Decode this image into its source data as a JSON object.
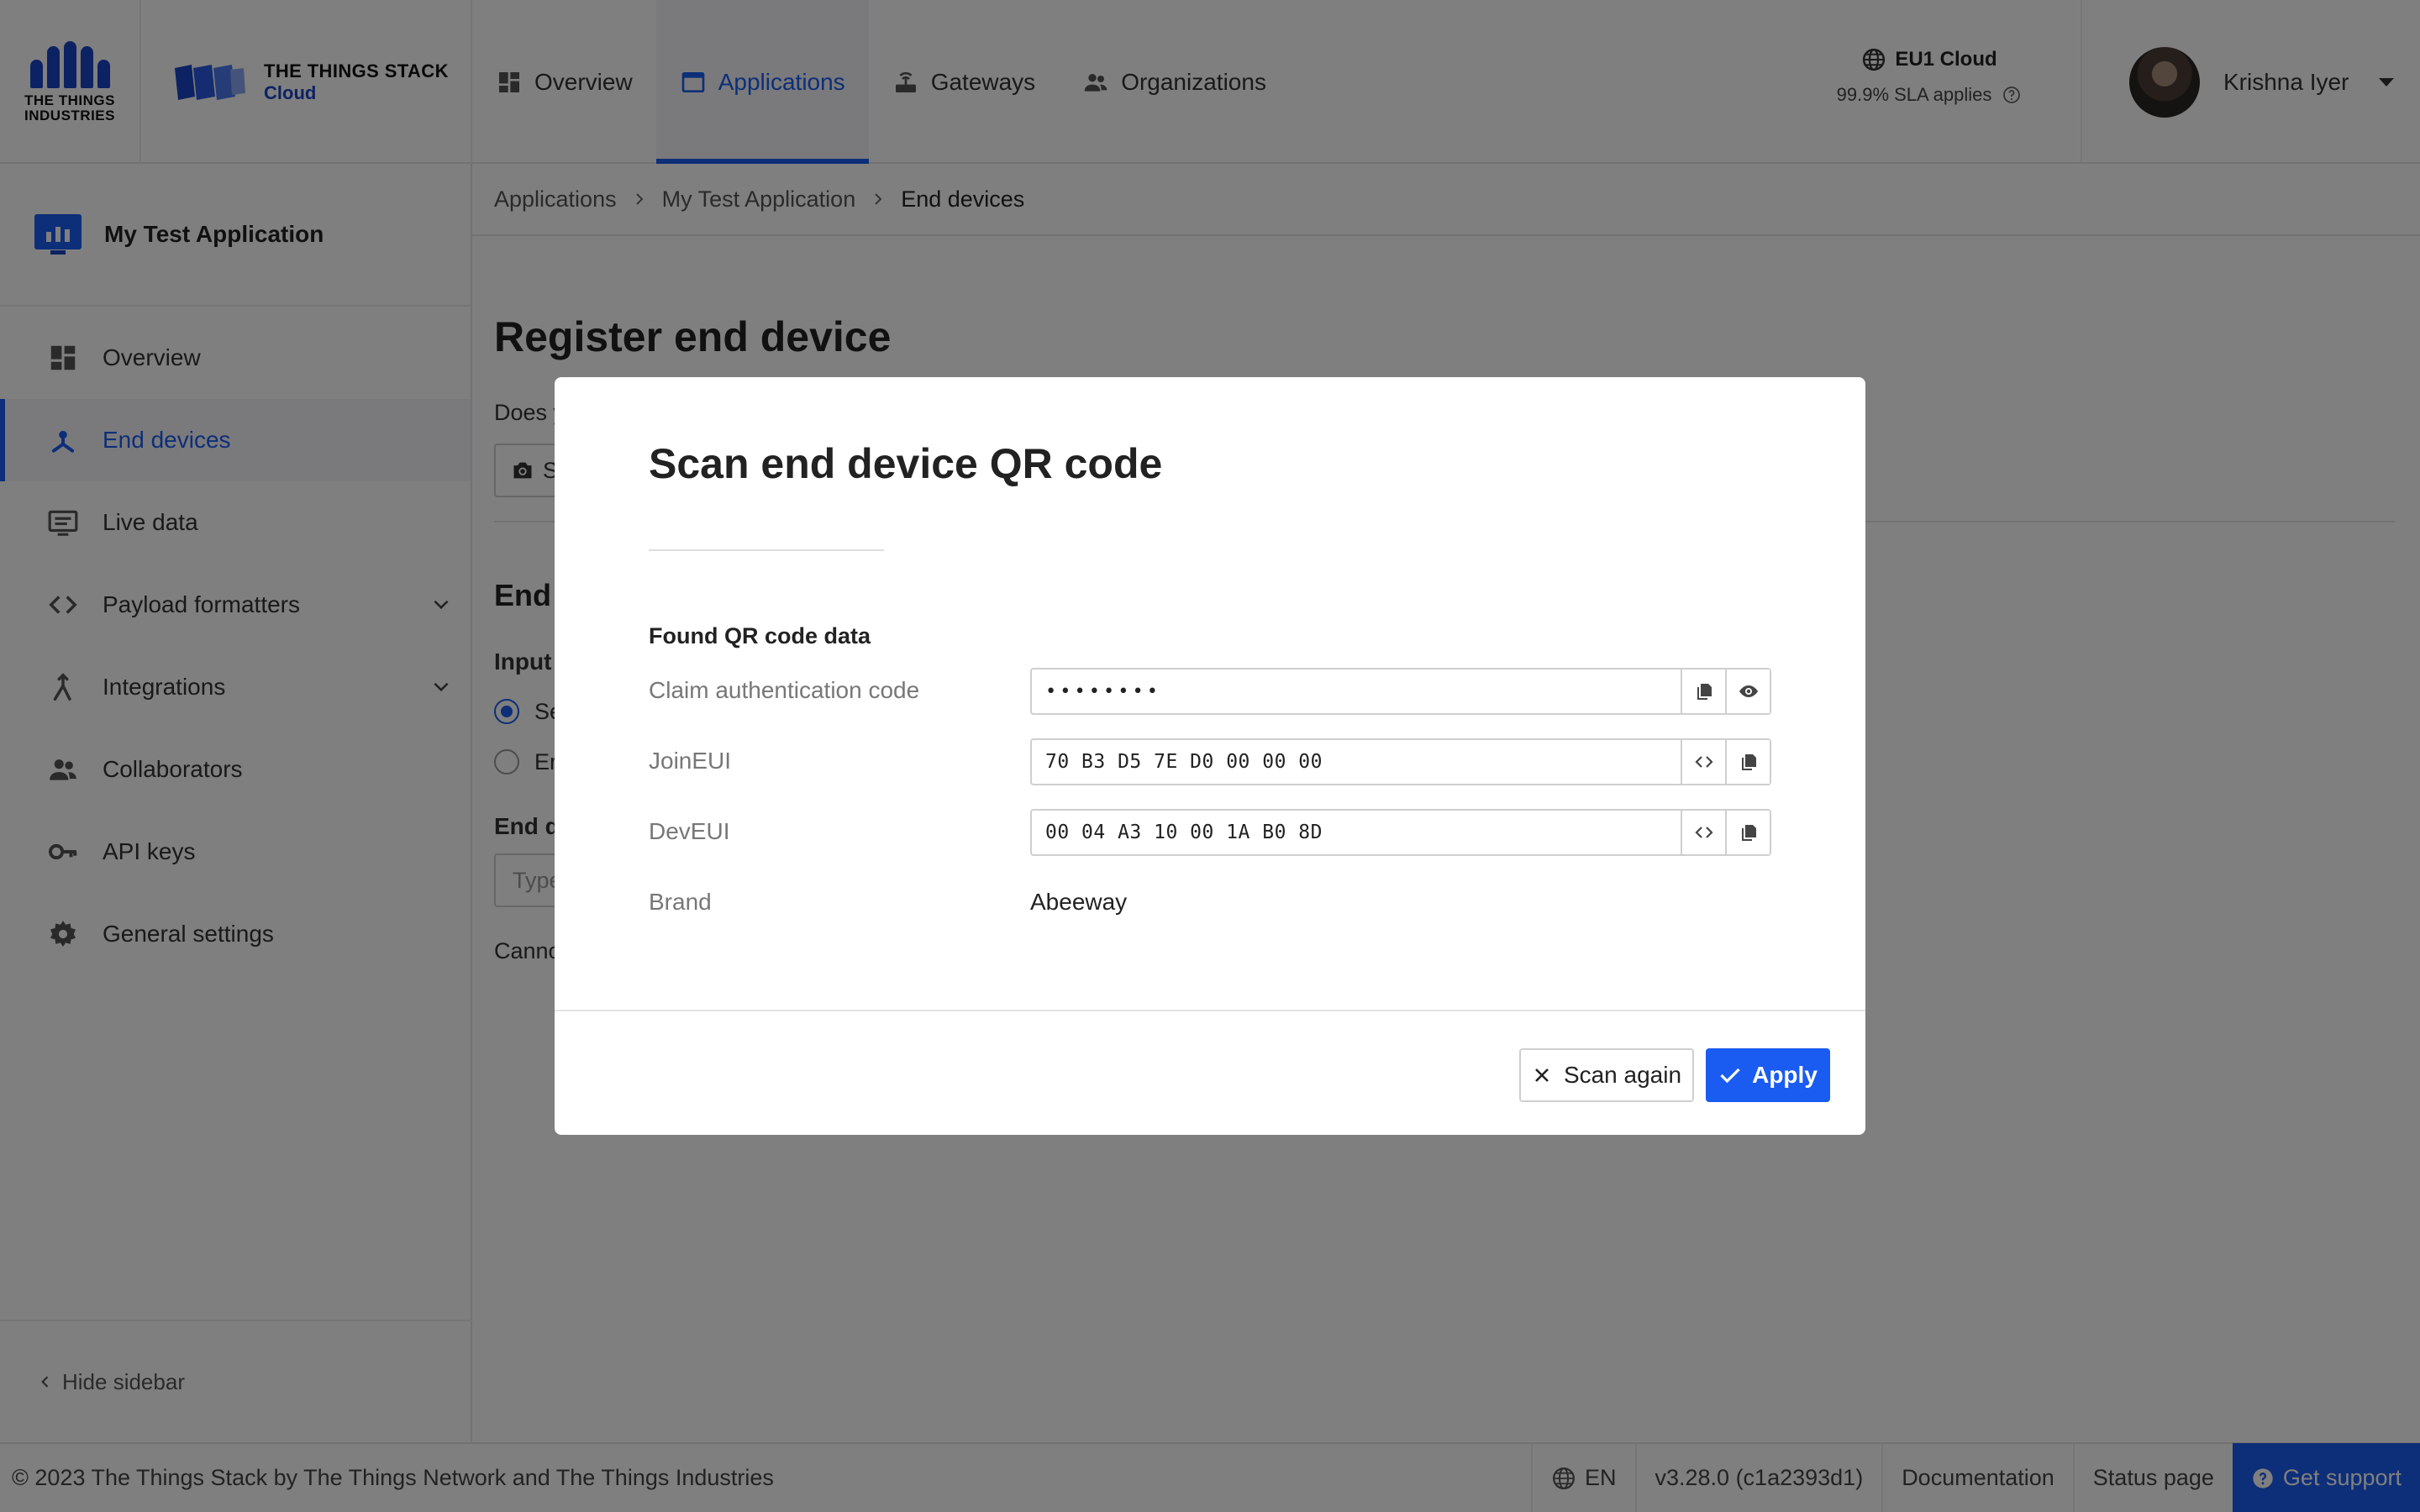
{
  "header": {
    "tti_logo_text": "THE THINGS INDUSTRIES",
    "tts_line1": "THE THINGS STACK",
    "tts_line2": "Cloud",
    "nav": [
      {
        "label": "Overview",
        "icon": "dashboard-icon"
      },
      {
        "label": "Applications",
        "icon": "application-icon",
        "active": true
      },
      {
        "label": "Gateways",
        "icon": "gateway-icon"
      },
      {
        "label": "Organizations",
        "icon": "organizations-icon"
      }
    ],
    "cluster": {
      "name": "EU1 Cloud",
      "sla": "99.9% SLA applies"
    },
    "user": {
      "name": "Krishna Iyer"
    }
  },
  "sidebar": {
    "app_title": "My Test Application",
    "items": [
      {
        "label": "Overview",
        "icon": "dashboard-icon"
      },
      {
        "label": "End devices",
        "icon": "devices-icon",
        "active": true
      },
      {
        "label": "Live data",
        "icon": "live-data-icon"
      },
      {
        "label": "Payload formatters",
        "icon": "code-icon",
        "expandable": true
      },
      {
        "label": "Integrations",
        "icon": "integrations-icon",
        "expandable": true
      },
      {
        "label": "Collaborators",
        "icon": "collaborators-icon"
      },
      {
        "label": "API keys",
        "icon": "key-icon"
      },
      {
        "label": "General settings",
        "icon": "gear-icon"
      }
    ],
    "hide_label": "Hide sidebar"
  },
  "breadcrumbs": [
    "Applications",
    "My Test Application",
    "End devices"
  ],
  "page": {
    "title": "Register end device",
    "question_fragment": "Does y",
    "scan_btn_fragment": "S",
    "section_fragment": "End d",
    "input_fragment": "Input",
    "radio1_fragment": "Se",
    "radio2_fragment": "Er",
    "enddev_fragment": "End de",
    "type_placeholder_fragment": "Type",
    "cannot_fragment": "Canno"
  },
  "modal": {
    "title": "Scan end device QR code",
    "section_label": "Found QR code data",
    "fields": {
      "claim": {
        "label": "Claim authentication code",
        "value": "••••••••"
      },
      "joineui": {
        "label": "JoinEUI",
        "value": "70 B3 D5 7E D0 00 00 00"
      },
      "deveui": {
        "label": "DevEUI",
        "value": "00 04 A3 10 00 1A B0 8D"
      },
      "brand": {
        "label": "Brand",
        "value": "Abeeway"
      }
    },
    "scan_again_label": "Scan again",
    "apply_label": "Apply"
  },
  "footer": {
    "copyright": "© 2023 The Things Stack by The Things Network and The Things Industries",
    "language": "EN",
    "version": "v3.28.0 (c1a2393d1)",
    "documentation": "Documentation",
    "status_page": "Status page",
    "support": "Get support"
  },
  "colors": {
    "accent": "#1a5cf1",
    "brand_blue": "#1a44c7"
  }
}
